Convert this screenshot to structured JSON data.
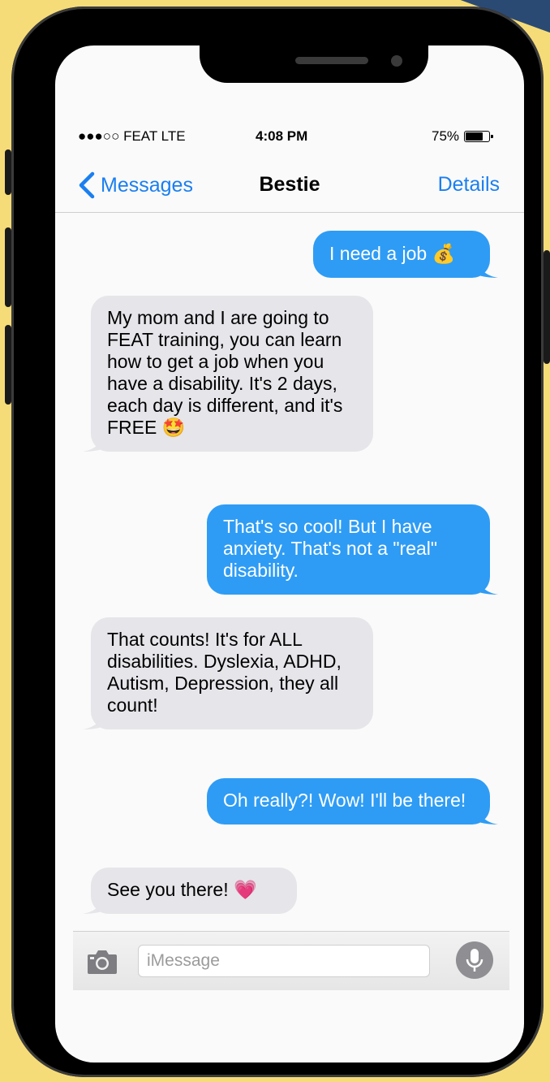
{
  "status": {
    "carrier": "●●●○○ FEAT  LTE",
    "time": "4:08 PM",
    "battery_text": "75%",
    "battery_level": 0.75
  },
  "nav": {
    "back_label": "Messages",
    "title": "Bestie",
    "details_label": "Details"
  },
  "messages": [
    {
      "from": "me",
      "text": "I need a job 💰"
    },
    {
      "from": "them",
      "text": "My mom and I are going to FEAT training, you can learn how to get a job when you have a disability. It's 2 days, each day is different, and it's FREE 🤩"
    },
    {
      "from": "me",
      "text": "That's so cool! But I have anxiety. That's not a \"real\" disability."
    },
    {
      "from": "them",
      "text": "That counts! It's for ALL disabilities. Dyslexia, ADHD, Autism, Depression, they all count!"
    },
    {
      "from": "me",
      "text": "Oh really?! Wow! I'll be there!"
    },
    {
      "from": "them",
      "text": "See you there! 💗"
    }
  ],
  "composer": {
    "placeholder": "iMessage"
  },
  "colors": {
    "background": "#f6dc78",
    "sent_bubble": "#2e9cf5",
    "received_bubble": "#e5e5ea",
    "link_blue": "#1a7ff0"
  }
}
